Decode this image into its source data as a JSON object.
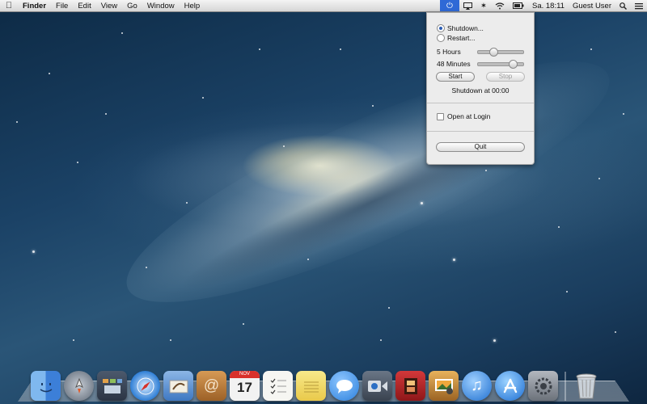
{
  "menubar": {
    "app_name": "Finder",
    "menus": [
      "File",
      "Edit",
      "View",
      "Go",
      "Window",
      "Help"
    ],
    "clock": "Sa. 18:11",
    "user": "Guest User"
  },
  "popover": {
    "shutdown_label": "Shutdown...",
    "restart_label": "Restart...",
    "selected": "shutdown",
    "hours_label": "5 Hours",
    "hours_level": 0.3,
    "minutes_label": "48 Minutes",
    "minutes_level": 0.8,
    "start_label": "Start",
    "stop_label": "Stop",
    "status_text": "Shutdown at 00:00",
    "open_at_login_label": "Open at Login",
    "open_at_login_checked": false,
    "quit_label": "Quit"
  },
  "dock": {
    "calendar_month": "NOV",
    "calendar_day": "17",
    "apps": [
      {
        "name": "finder-icon",
        "color": "#3c7fd8"
      },
      {
        "name": "launchpad-icon",
        "color": "#6f7a88"
      },
      {
        "name": "mission-control-icon",
        "color": "#3e4b5c"
      },
      {
        "name": "safari-icon",
        "color": "#2f7fd6"
      },
      {
        "name": "mail-icon",
        "color": "#5a8fcf"
      },
      {
        "name": "contacts-icon",
        "color": "#b57a3a"
      },
      {
        "name": "calendar-icon",
        "color": "#f2f2f2"
      },
      {
        "name": "reminders-icon",
        "color": "#f6f6f2"
      },
      {
        "name": "notes-icon",
        "color": "#f1dd6a"
      },
      {
        "name": "messages-icon",
        "color": "#3b8fe0"
      },
      {
        "name": "facetime-icon",
        "color": "#4b5562"
      },
      {
        "name": "photo-booth-icon",
        "color": "#b8262a"
      },
      {
        "name": "iphoto-icon",
        "color": "#c68a3a"
      },
      {
        "name": "itunes-icon",
        "color": "#2c7ed4"
      },
      {
        "name": "app-store-icon",
        "color": "#2f7dd8"
      },
      {
        "name": "system-preferences-icon",
        "color": "#8a8f96"
      }
    ]
  }
}
